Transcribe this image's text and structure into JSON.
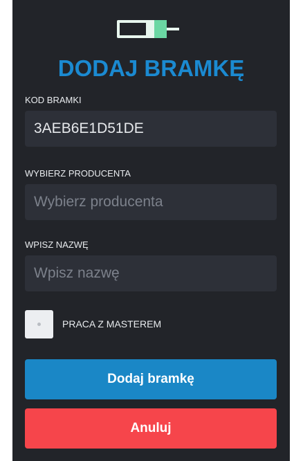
{
  "brand": {
    "logo_icon": "battery-icon",
    "accent_color": "#1b8ad1"
  },
  "header": {
    "title": "DODAJ BRAMKĘ"
  },
  "form": {
    "code": {
      "label": "KOD BRAMKI",
      "value": "3AEB6E1D51DE"
    },
    "producer": {
      "label": "WYBIERZ PRODUCENTA",
      "placeholder": "Wybierz producenta",
      "value": ""
    },
    "name": {
      "label": "WPISZ NAZWĘ",
      "placeholder": "Wpisz nazwę",
      "value": ""
    },
    "master": {
      "label": "PRACA Z MASTEREM",
      "checked": false
    }
  },
  "actions": {
    "submit_label": "Dodaj bramkę",
    "submit_color": "#1a87c6",
    "cancel_label": "Anuluj",
    "cancel_color": "#f6454b"
  }
}
